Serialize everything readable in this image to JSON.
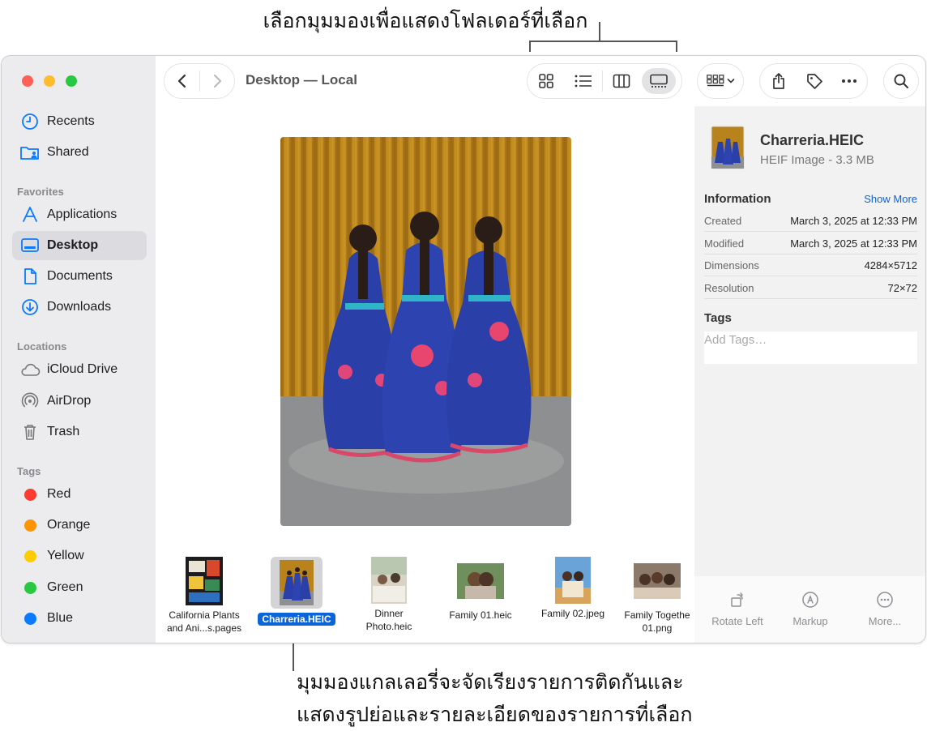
{
  "callouts": {
    "top": "เลือกมุมมองเพื่อแสดงโฟลเดอร์ที่เลือก",
    "bottom_line1": "มุมมองแกลเลอรี่จะจัดเรียงรายการติดกันและ",
    "bottom_line2": "แสดงรูปย่อและรายละเอียดของรายการที่เลือก"
  },
  "window": {
    "title": "Desktop — Local"
  },
  "sidebar": {
    "items_top": [
      {
        "label": "Recents",
        "icon": "clock-icon"
      },
      {
        "label": "Shared",
        "icon": "shared-folder-icon"
      }
    ],
    "favorites_label": "Favorites",
    "favorites": [
      {
        "label": "Applications",
        "icon": "applications-icon"
      },
      {
        "label": "Desktop",
        "icon": "desktop-icon"
      },
      {
        "label": "Documents",
        "icon": "document-icon"
      },
      {
        "label": "Downloads",
        "icon": "download-icon"
      }
    ],
    "locations_label": "Locations",
    "locations": [
      {
        "label": "iCloud Drive",
        "icon": "cloud-icon"
      },
      {
        "label": "AirDrop",
        "icon": "airdrop-icon"
      },
      {
        "label": "Trash",
        "icon": "trash-icon"
      }
    ],
    "tags_label": "Tags",
    "tags": [
      {
        "label": "Red",
        "color": "#fe3b30"
      },
      {
        "label": "Orange",
        "color": "#fe9500"
      },
      {
        "label": "Yellow",
        "color": "#fecc00"
      },
      {
        "label": "Green",
        "color": "#28c840"
      },
      {
        "label": "Blue",
        "color": "#0a7aff"
      }
    ]
  },
  "gallery": {
    "thumbnails": [
      {
        "line1": "California Plants",
        "line2": "and Ani...s.pages"
      },
      {
        "line1": "Charreria.HEIC",
        "line2": ""
      },
      {
        "line1": "Dinner",
        "line2": "Photo.heic"
      },
      {
        "line1": "Family 01.heic",
        "line2": ""
      },
      {
        "line1": "Family 02.jpeg",
        "line2": ""
      },
      {
        "line1": "Family Togethe",
        "line2": "01.png"
      }
    ]
  },
  "inspector": {
    "file_name": "Charreria.HEIC",
    "file_kind": "HEIF Image - 3.3 MB",
    "information_label": "Information",
    "show_more": "Show More",
    "rows": [
      {
        "key": "Created",
        "value": "March 3, 2025 at 12:33 PM"
      },
      {
        "key": "Modified",
        "value": "March 3, 2025 at 12:33 PM"
      },
      {
        "key": "Dimensions",
        "value": "4284×5712"
      },
      {
        "key": "Resolution",
        "value": "72×72"
      }
    ],
    "tags_label": "Tags",
    "tags_placeholder": "Add Tags…",
    "actions": [
      {
        "label": "Rotate Left",
        "icon": "rotate-left-icon"
      },
      {
        "label": "Markup",
        "icon": "markup-icon"
      },
      {
        "label": "More...",
        "icon": "more-circle-icon"
      }
    ]
  }
}
